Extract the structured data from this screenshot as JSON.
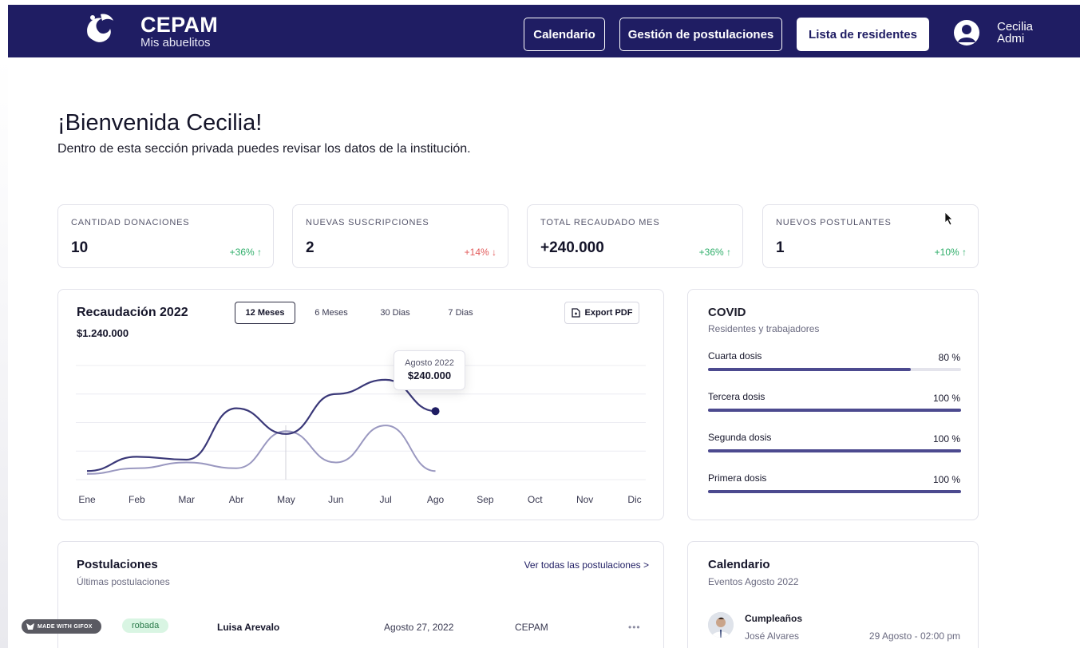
{
  "header": {
    "brand_title": "CEPAM",
    "brand_subtitle": "Mis abuelitos",
    "nav": [
      "Calendario",
      "Gestión de postulaciones",
      "Lista de residentes"
    ],
    "active_nav": "Lista de residentes",
    "user_first_name": "Cecilia",
    "user_role": "Admi",
    "brand_color": "#1f1d63"
  },
  "welcome": {
    "title": "¡Bienvenida Cecilia!",
    "subtitle": "Dentro de esta sección privada puedes revisar los datos de la institución."
  },
  "stats": [
    {
      "label": "CANTIDAD DONACIONES",
      "value": "10",
      "change": "+36% ↑",
      "trend": "up"
    },
    {
      "label": "NUEVAS SUSCRIPCIONES",
      "value": "2",
      "change": "+14% ↓",
      "trend": "down"
    },
    {
      "label": "TOTAL RECAUDADO MES",
      "value": "+240.000",
      "change": "+36% ↑",
      "trend": "up"
    },
    {
      "label": "NUEVOS POSTULANTES",
      "value": "1",
      "change": "+10% ↑",
      "trend": "up"
    }
  ],
  "recaudacion": {
    "title": "Recaudación 2022",
    "total": "$1.240.000",
    "ranges": [
      "12 Meses",
      "6 Meses",
      "30 Dias",
      "7 Dias"
    ],
    "active_range": "12 Meses",
    "export_label": "Export PDF",
    "tooltip_label": "Agosto 2022",
    "tooltip_value": "$240.000"
  },
  "chart_data": {
    "type": "line",
    "categories": [
      "Ene",
      "Feb",
      "Mar",
      "Abr",
      "May",
      "Jun",
      "Jul",
      "Ago",
      "Sep",
      "Oct",
      "Nov",
      "Dic"
    ],
    "series": [
      {
        "values": [
          30000,
          80000,
          70000,
          250000,
          160000,
          300000,
          350000,
          240000,
          null,
          null,
          null,
          null
        ]
      },
      {
        "values": [
          20000,
          40000,
          60000,
          40000,
          170000,
          60000,
          190000,
          30000,
          null,
          null,
          null,
          null
        ]
      }
    ],
    "highlight": {
      "category": "Ago",
      "value": 240000
    },
    "colors": [
      "#3a3878",
      "#9a98c0"
    ],
    "grid": true
  },
  "covid": {
    "title": "COVID",
    "subtitle": "Residentes y trabajadores",
    "doses": [
      {
        "label": "Cuarta dosis",
        "percent_label": "80 %",
        "value": 80
      },
      {
        "label": "Tercera dosis",
        "percent_label": "100 %",
        "value": 100
      },
      {
        "label": "Segunda dosis",
        "percent_label": "100 %",
        "value": 100
      },
      {
        "label": "Primera dosis",
        "percent_label": "100 %",
        "value": 100
      }
    ],
    "bar_color": "#4c4a8f"
  },
  "postulaciones": {
    "title": "Postulaciones",
    "subtitle": "Últimas postulaciones",
    "see_all": "Ver todas las postulaciones >",
    "rows": [
      {
        "status": "robada",
        "name": "Luisa Arevalo",
        "date": "Agosto 27, 2022",
        "institution": "CEPAM",
        "more": "•••"
      }
    ]
  },
  "calendario": {
    "title": "Calendario",
    "subtitle": "Eventos Agosto 2022",
    "events": [
      {
        "title": "Cumpleaños",
        "person": "José Alvares",
        "when": "29 Agosto - 02:00 pm"
      }
    ]
  },
  "watermark": "MADE WITH GIFOX"
}
